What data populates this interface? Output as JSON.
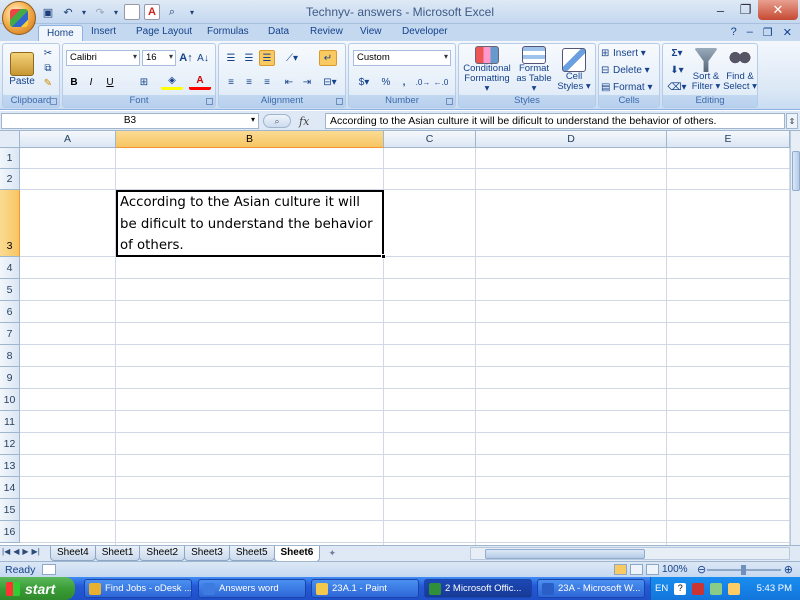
{
  "window": {
    "title": "Technyv- answers - Microsoft Excel",
    "min_icon": "minimize-icon",
    "max_icon": "restore-icon",
    "close_icon": "close-icon"
  },
  "ribbon_tabs": [
    {
      "label": "Home",
      "active": true
    },
    {
      "label": "Insert"
    },
    {
      "label": "Page Layout"
    },
    {
      "label": "Formulas"
    },
    {
      "label": "Data"
    },
    {
      "label": "Review"
    },
    {
      "label": "View"
    },
    {
      "label": "Developer"
    }
  ],
  "ribbon": {
    "clipboard": {
      "label": "Clipboard",
      "paste": "Paste"
    },
    "font": {
      "label": "Font",
      "name": "Calibri",
      "size": "16",
      "bold": "B",
      "italic": "I",
      "underline": "U"
    },
    "alignment": {
      "label": "Alignment"
    },
    "number": {
      "label": "Number",
      "format": "Custom",
      "currency": "$",
      "percent": "%",
      "comma": ","
    },
    "styles": {
      "label": "Styles",
      "conditional": "Conditional",
      "conditional2": "Formatting",
      "format_table": "Format",
      "format_table2": "as Table",
      "cell_styles": "Cell",
      "cell_styles2": "Styles"
    },
    "cells": {
      "label": "Cells",
      "insert": "Insert",
      "delete": "Delete",
      "format": "Format"
    },
    "editing": {
      "label": "Editing",
      "sort": "Sort &",
      "sort2": "Filter",
      "find": "Find &",
      "find2": "Select"
    }
  },
  "formula_bar": {
    "name_box": "B3",
    "fx": "fx",
    "content": "According to the Asian culture it will be dificult to understand the behavior of others."
  },
  "grid": {
    "columns": [
      "A",
      "B",
      "C",
      "D",
      "E"
    ],
    "selected_column": "B",
    "rows": [
      "1",
      "2",
      "3",
      "4",
      "5",
      "6",
      "7",
      "8",
      "9",
      "10",
      "11",
      "12",
      "13",
      "14",
      "15",
      "16"
    ],
    "selected_row": "3",
    "cell_b3": "According to the Asian culture it will be dificult to understand the behavior of others."
  },
  "sheets": [
    {
      "label": "Sheet4"
    },
    {
      "label": "Sheet1"
    },
    {
      "label": "Sheet2"
    },
    {
      "label": "Sheet3"
    },
    {
      "label": "Sheet5"
    },
    {
      "label": "Sheet6",
      "active": true
    }
  ],
  "status": {
    "mode": "Ready",
    "zoom": "100%",
    "zoom_percent": 100
  },
  "taskbar": {
    "start": "start",
    "tasks": [
      {
        "label": "Find Jobs - oDesk ...",
        "color": "#e8b030"
      },
      {
        "label": "Answers word",
        "color": "#3d7be0"
      },
      {
        "label": "23A.1 - Paint",
        "color": "#f2c94c"
      },
      {
        "label": "2 Microsoft Offic...",
        "color": "#2f8f3a",
        "active": true
      },
      {
        "label": "23A - Microsoft W...",
        "color": "#2a5fc7"
      }
    ],
    "language": "EN",
    "clock": "5:43 PM"
  },
  "colors": {
    "accent": "#15428b",
    "selection_header": "#f7c662",
    "ribbon_bg": "#dce8f6",
    "taskbar": "#2459d6"
  }
}
